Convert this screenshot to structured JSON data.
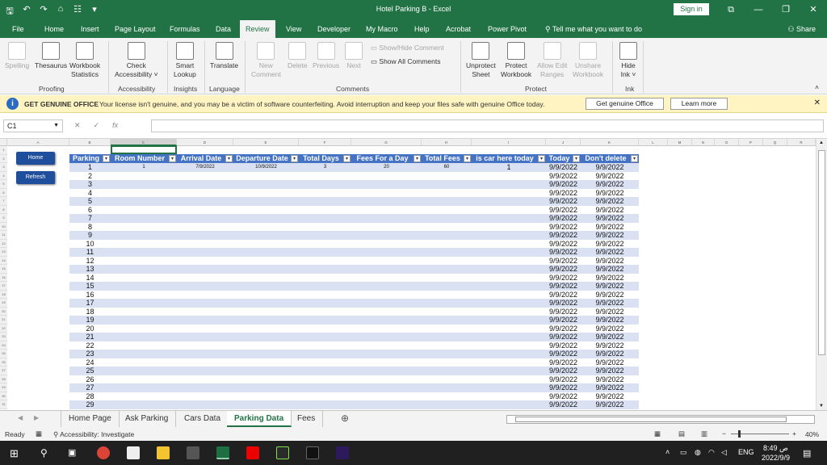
{
  "window": {
    "title": "Hotel Parking B  -  Excel",
    "signin": "Sign in",
    "share": "Share",
    "tell_me": "Tell me what you want to do"
  },
  "ribbon_tabs": [
    "File",
    "Home",
    "Insert",
    "Page Layout",
    "Formulas",
    "Data",
    "Review",
    "View",
    "Developer",
    "My Macro",
    "Help",
    "Acrobat",
    "Power Pivot"
  ],
  "active_tab": "Review",
  "ribbon": {
    "spelling": "Spelling",
    "thesaurus": "Thesaurus",
    "workbook_statistics_1": "Workbook",
    "workbook_statistics_2": "Statistics",
    "check_accessibility_1": "Check",
    "check_accessibility_2": "Accessibility ˅",
    "smart_lookup_1": "Smart",
    "smart_lookup_2": "Lookup",
    "translate": "Translate",
    "new_comment_1": "New",
    "new_comment_2": "Comment",
    "delete": "Delete",
    "previous": "Previous",
    "next": "Next",
    "show_hide_comment": "Show/Hide Comment",
    "show_all_comments": "Show All Comments",
    "unprotect_sheet_1": "Unprotect",
    "unprotect_sheet_2": "Sheet",
    "protect_workbook_1": "Protect",
    "protect_workbook_2": "Workbook",
    "allow_edit_ranges_1": "Allow Edit",
    "allow_edit_ranges_2": "Ranges",
    "unshare_workbook_1": "Unshare",
    "unshare_workbook_2": "Workbook",
    "hide_ink_1": "Hide",
    "hide_ink_2": "Ink ˅",
    "groups": {
      "proofing": "Proofing",
      "accessibility": "Accessibility",
      "insights": "Insights",
      "language": "Language",
      "comments": "Comments",
      "protect": "Protect",
      "ink": "Ink"
    }
  },
  "message_bar": {
    "title": "GET GENUINE OFFICE",
    "text": "Your license isn't genuine, and you may be a victim of software counterfeiting. Avoid interruption and keep your files safe with genuine Office today.",
    "button_genuine": "Get genuine Office",
    "button_learn": "Learn more"
  },
  "formula_bar": {
    "name_box": "C1",
    "formula": ""
  },
  "sheet_buttons": {
    "home": "Home",
    "refresh": "Refresh"
  },
  "table": {
    "headers": [
      "Parking",
      "Room Number",
      "Arrival Date",
      "Departure Date",
      "Total Days",
      "Fees For a  Day",
      "Total Fees",
      "is car here today",
      "Today",
      "Don't delete"
    ],
    "first_row": {
      "room": "1",
      "arrival": "7/9/2022",
      "departure": "10/9/2022",
      "total_days": "3",
      "fees_day": "20",
      "total_fees": "60",
      "car_here": "1"
    },
    "parking_numbers": [
      "1",
      "2",
      "3",
      "4",
      "5",
      "6",
      "7",
      "8",
      "9",
      "10",
      "11",
      "12",
      "13",
      "14",
      "15",
      "16",
      "17",
      "18",
      "19",
      "20",
      "21",
      "22",
      "23",
      "24",
      "25",
      "26",
      "27",
      "28",
      "29"
    ],
    "today_value": "9/9/2022",
    "dont_delete_value": "9/9/2022"
  },
  "sheet_tabs": [
    "Home Page",
    "Ask Parking",
    "Cars Data",
    "Parking Data",
    "Fees"
  ],
  "active_sheet": "Parking Data",
  "status": {
    "ready": "Ready",
    "accessibility": "Accessibility: Investigate",
    "zoom": "40%"
  },
  "taskbar": {
    "time": "8:49 ص",
    "date": "2022/9/9",
    "language": "ENG"
  },
  "colors": {
    "excel_green": "#217346",
    "table_header": "#4472c4",
    "band_light": "#d9e1f2",
    "button_blue": "#1f4e9c"
  }
}
